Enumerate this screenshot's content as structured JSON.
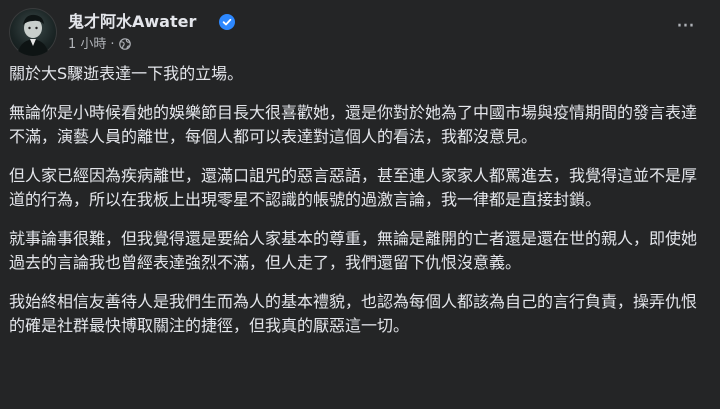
{
  "header": {
    "author_name": "鬼才阿水Awater",
    "timestamp": "1 小時",
    "separator": "·",
    "privacy_icon": "globe-icon",
    "verified_icon": "verified-badge-icon",
    "more_icon": "more-options-icon"
  },
  "colors": {
    "background": "#242526",
    "text_primary": "#e4e6eb",
    "text_secondary": "#b0b3b8",
    "verified_blue": "#2d88ff"
  },
  "post": {
    "paragraphs": [
      "關於大S驟逝表達一下我的立場。",
      "無論你是小時候看她的娛樂節目長大很喜歡她，還是你對於她為了中國市場與疫情期間的發言表達不滿，演藝人員的離世，每個人都可以表達對這個人的看法，我都沒意見。",
      "但人家已經因為疾病離世，還滿口詛咒的惡言惡語，甚至連人家家人都罵進去，我覺得這並不是厚道的行為，所以在我板上出現零星不認識的帳號的過激言論，我一律都是直接封鎖。",
      "就事論事很難，但我覺得還是要給人家基本的尊重，無論是離開的亡者還是還在世的親人，即使她過去的言論我也曾經表達強烈不滿，但人走了，我們還留下仇恨沒意義。",
      "我始終相信友善待人是我們生而為人的基本禮貌，也認為每個人都該為自己的言行負責，操弄仇恨的確是社群最快博取關注的捷徑，但我真的厭惡這一切。"
    ]
  }
}
